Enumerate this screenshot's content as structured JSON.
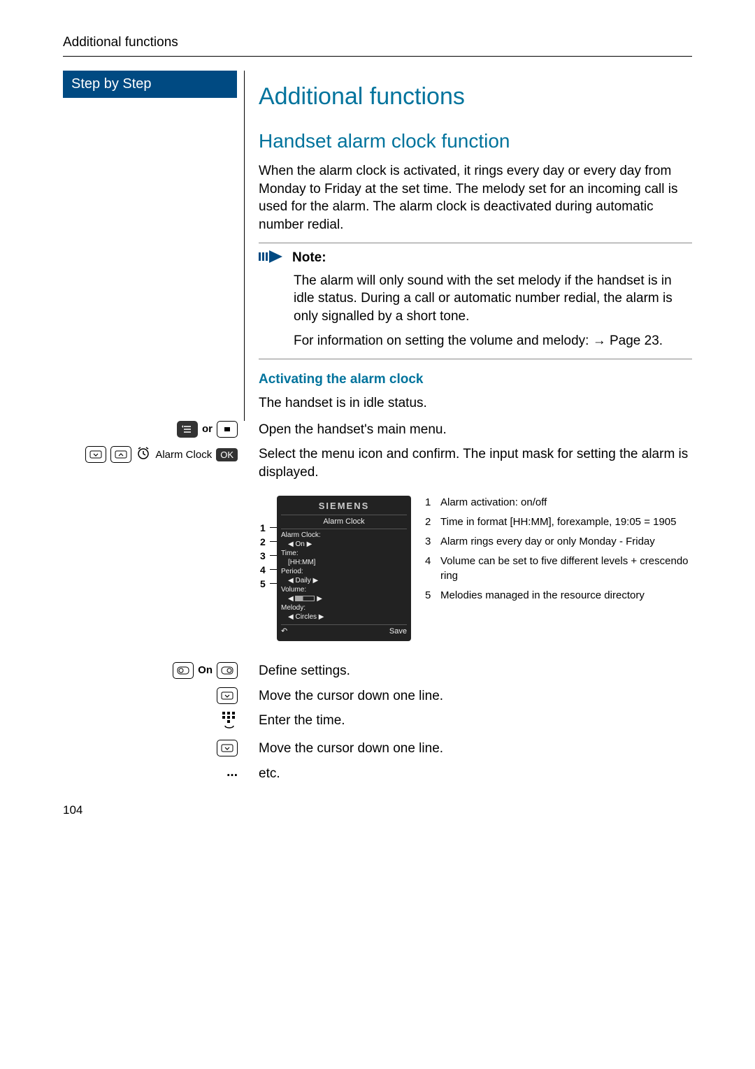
{
  "header": {
    "running": "Additional functions"
  },
  "sidebar": {
    "step_label": "Step by Step"
  },
  "main": {
    "title": "Additional functions",
    "subtitle": "Handset alarm clock function",
    "intro": "When the alarm clock is activated, it rings every day or every day from Monday to Friday at the set time. The melody set for an incoming call is used for the alarm. The alarm clock is deactivated during automatic number redial.",
    "note": {
      "label": "Note:",
      "p1": "The alarm will only sound with the set melody if the handset is in idle status. During a call or automatic number redial, the alarm is only signalled by a short tone.",
      "p2": "For information on setting the volume and melody: → Page 23."
    },
    "sub3": "Activating the alarm clock",
    "idle": "The handset is in idle status.",
    "steps": {
      "open_menu": "Open the handset's main menu.",
      "or_label": "or",
      "alarm_clock_label": "Alarm Clock",
      "ok_label": "OK",
      "select_confirm": "Select the menu icon and confirm. The input mask for setting the alarm is displayed.",
      "define": "Define settings.",
      "on_label": "On",
      "move_down1": "Move the cursor down one line.",
      "enter_time": "Enter the time.",
      "move_down2": "Move the cursor down one line.",
      "etc_label": "...",
      "etc": "etc."
    },
    "phone": {
      "brand": "SIEMENS",
      "title": "Alarm Clock",
      "line1": "Alarm Clock:",
      "line1v": "◀  On  ▶",
      "line2": "Time:",
      "line2v": "[HH:MM]",
      "line3": "Period:",
      "line3v": "◀  Daily  ▶",
      "line4": "Volume:",
      "line5": "Melody:",
      "line5v": "◀ Circles  ▶",
      "back": "↶",
      "save": "Save"
    },
    "legend": {
      "i1": "Alarm activation: on/off",
      "i2": "Time in format [HH:MM], forexample, 19:05 = 1905",
      "i3": "Alarm rings every day or only Monday - Friday",
      "i4": "Volume can be set to five different levels + crescendo ring",
      "i5": "Melodies managed in the resource directory"
    }
  },
  "footer": {
    "page": "104"
  }
}
